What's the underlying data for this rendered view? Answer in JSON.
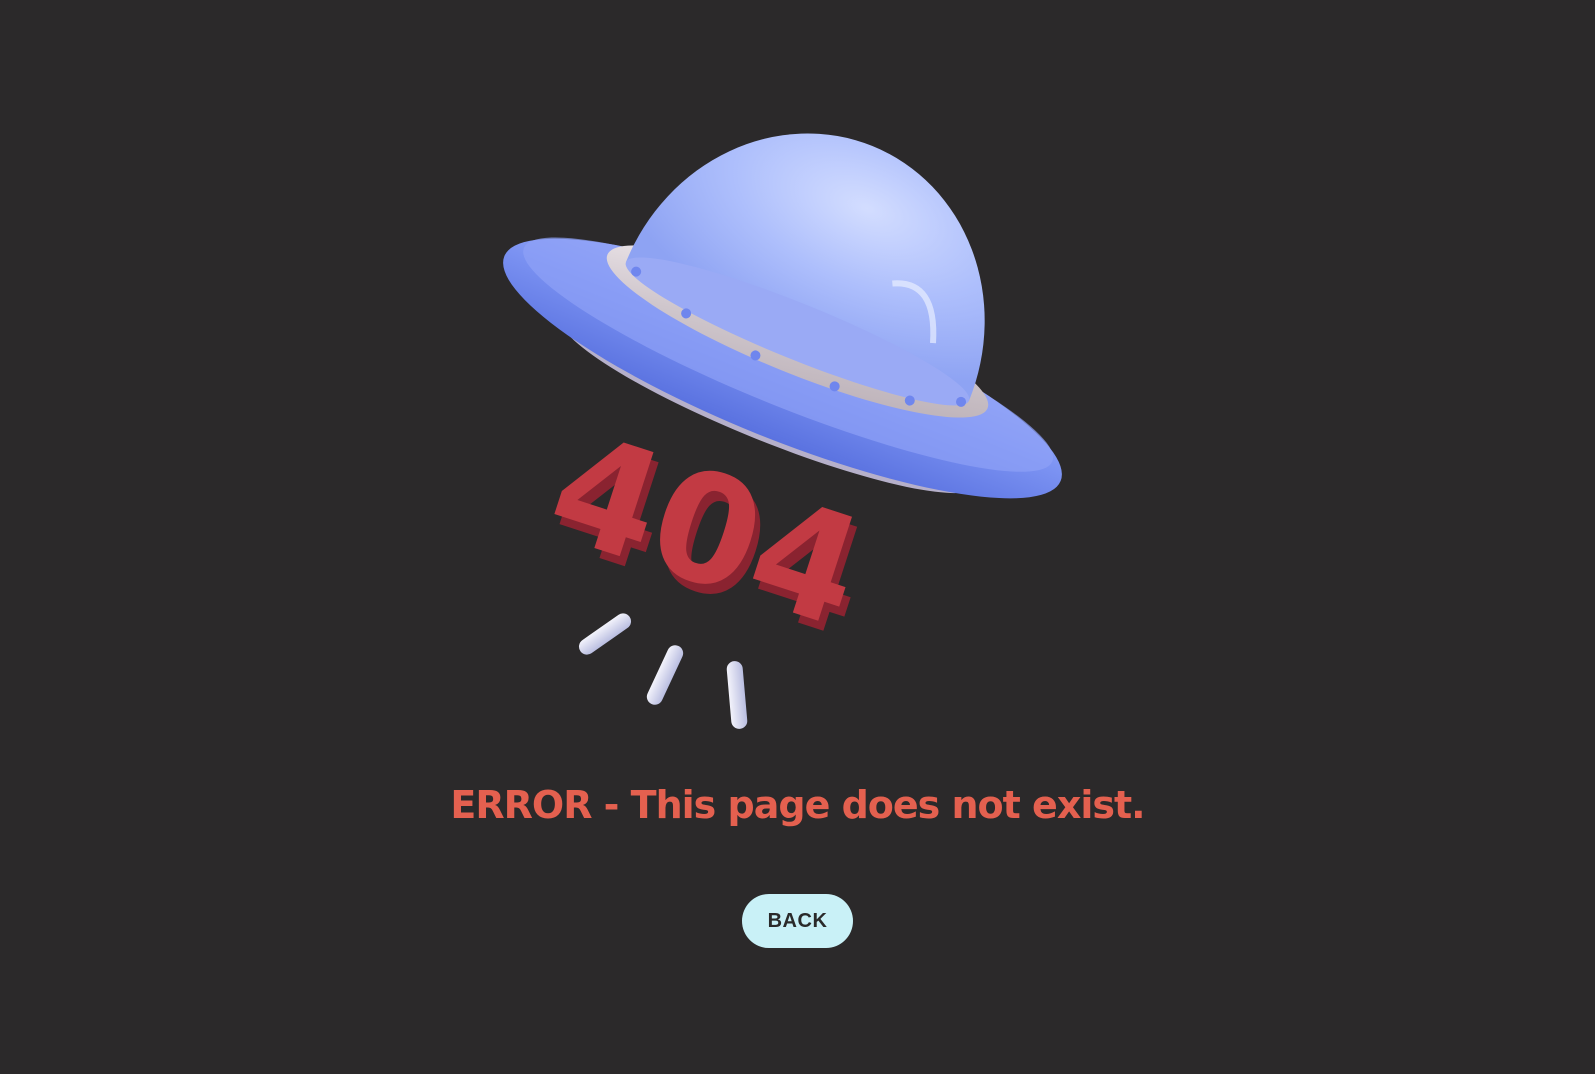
{
  "illustration": {
    "code_text": "404",
    "colors": {
      "background": "#2b292a",
      "saucer": "#6f86ee",
      "dome": "#a9b9fb",
      "rim": "#d9d1d6",
      "code": "#c23a43"
    }
  },
  "message": {
    "text": "ERROR - This page does not exist.",
    "color": "#e4604f"
  },
  "back_button": {
    "label": "BACK",
    "background": "#c9f1f7"
  }
}
